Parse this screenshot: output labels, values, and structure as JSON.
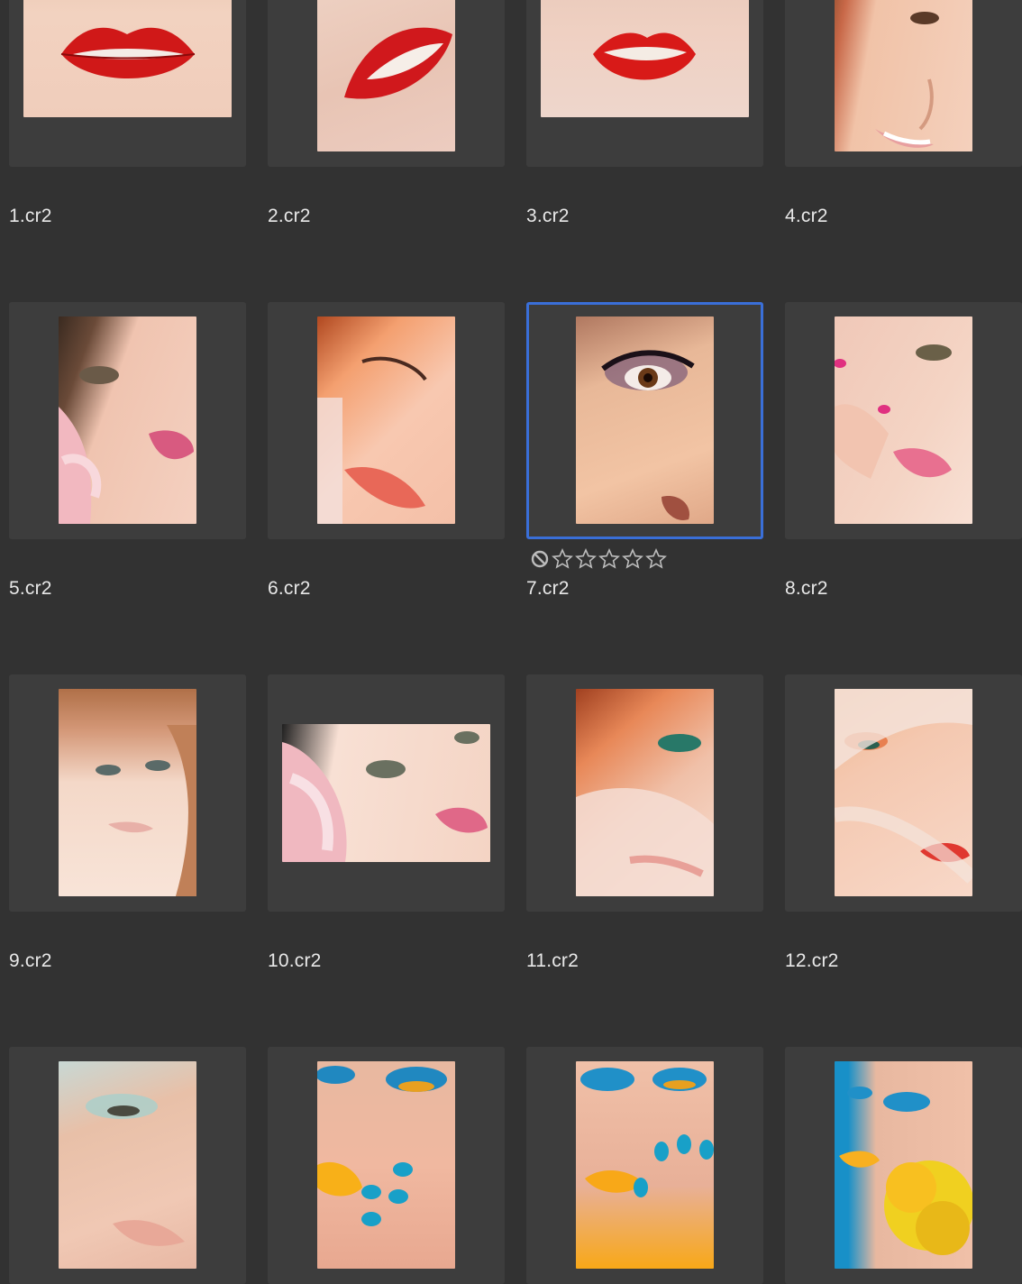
{
  "grid": {
    "items": [
      {
        "name": "1.cr2",
        "subject": "red-lips-closeup",
        "colors": [
          "#f2d2c0",
          "#e8c0a8",
          "#d01818",
          "#f2d0bc"
        ]
      },
      {
        "name": "2.cr2",
        "subject": "red-lips-angled",
        "colors": [
          "#f0d6c8",
          "#e8c4b4",
          "#d0181c",
          "#ecccc0"
        ]
      },
      {
        "name": "3.cr2",
        "subject": "red-lips-smile",
        "colors": [
          "#eed6cc",
          "#e8c8b8",
          "#d81a18",
          "#efd0c2"
        ]
      },
      {
        "name": "4.cr2",
        "subject": "face-side-smile",
        "colors": [
          "#8a4a2a",
          "#f1c3a8",
          "#e8a888",
          "#c86848"
        ]
      },
      {
        "name": "5.cr2",
        "subject": "face-pink-lily",
        "colors": [
          "#3a2a20",
          "#f0c4b0",
          "#f0b0b8",
          "#d85a80"
        ]
      },
      {
        "name": "6.cr2",
        "subject": "face-orange-eyeshadow",
        "colors": [
          "#b04820",
          "#f4a070",
          "#f8c8b0",
          "#e86858"
        ]
      },
      {
        "name": "7.cr2",
        "subject": "eye-lashes-closeup",
        "colors": [
          "#c89070",
          "#e8b898",
          "#f2c4a4",
          "#d89878"
        ]
      },
      {
        "name": "8.cr2",
        "subject": "face-pink-nails",
        "colors": [
          "#f0c8b8",
          "#f4d4c4",
          "#e87090",
          "#f8e0d4"
        ]
      },
      {
        "name": "9.cr2",
        "subject": "face-soft-hair",
        "colors": [
          "#b07048",
          "#f4d8c8",
          "#f8e4d8",
          "#d49878"
        ]
      },
      {
        "name": "10.cr2",
        "subject": "face-lily-landscape",
        "colors": [
          "#202020",
          "#f8e0d4",
          "#f0b8c0",
          "#e06888"
        ]
      },
      {
        "name": "11.cr2",
        "subject": "face-veil-orange",
        "colors": [
          "#a04020",
          "#e88858",
          "#f0c0a8",
          "#f8e0d4"
        ]
      },
      {
        "name": "12.cr2",
        "subject": "face-veil-red-lips",
        "colors": [
          "#f0b890",
          "#f8d8c8",
          "#f4c8b0",
          "#e03830"
        ]
      },
      {
        "name": "",
        "subject": "eye-teal-shadow",
        "colors": [
          "#c8d8d4",
          "#e8c0a8",
          "#f0c8b4",
          "#e8a898"
        ]
      },
      {
        "name": "",
        "subject": "face-blue-shadow-nails",
        "colors": [
          "#2088c0",
          "#f0b8a0",
          "#f8b018",
          "#18a0c8"
        ]
      },
      {
        "name": "",
        "subject": "face-blue-shadow-yellow-lips",
        "colors": [
          "#2090c8",
          "#f0c0a8",
          "#f8a818",
          "#e8b098"
        ]
      },
      {
        "name": "",
        "subject": "face-blue-bg-yellow-flower",
        "colors": [
          "#1890c8",
          "#e8b8a0",
          "#f8c020",
          "#f0d020"
        ]
      }
    ]
  },
  "selection": {
    "selected_item": "7.cr2",
    "rating_stars": 0,
    "rating_max": 5,
    "rejected": false
  },
  "accent_color": "#3a6fd8"
}
